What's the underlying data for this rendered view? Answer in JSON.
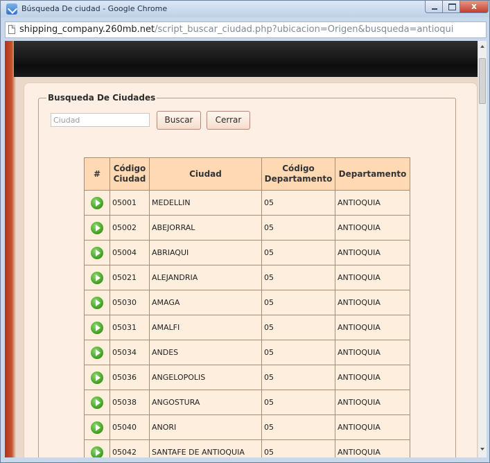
{
  "window": {
    "title": "Búsqueda De ciudad - Google Chrome",
    "close_glyph": "x"
  },
  "address_bar": {
    "host": "shipping_company.260mb.net",
    "path": "/script_buscar_ciudad.php?ubicacion=Origen&busqueda=antioqui"
  },
  "form": {
    "legend": "Busqueda De Ciudades",
    "search_placeholder": "Ciudad",
    "search_value": "",
    "buscar_label": "Buscar",
    "cerrar_label": "Cerrar"
  },
  "table": {
    "headers": {
      "hash": "#",
      "code_city": "Código Ciudad",
      "city": "Ciudad",
      "code_dept": "Código Departamento",
      "dept": "Departamento"
    },
    "rows": [
      {
        "code": "05001",
        "city": "MEDELLIN",
        "dept_code": "05",
        "dept": "ANTIOQUIA"
      },
      {
        "code": "05002",
        "city": "ABEJORRAL",
        "dept_code": "05",
        "dept": "ANTIOQUIA"
      },
      {
        "code": "05004",
        "city": "ABRIAQUI",
        "dept_code": "05",
        "dept": "ANTIOQUIA"
      },
      {
        "code": "05021",
        "city": "ALEJANDRIA",
        "dept_code": "05",
        "dept": "ANTIOQUIA"
      },
      {
        "code": "05030",
        "city": "AMAGA",
        "dept_code": "05",
        "dept": "ANTIOQUIA"
      },
      {
        "code": "05031",
        "city": "AMALFI",
        "dept_code": "05",
        "dept": "ANTIOQUIA"
      },
      {
        "code": "05034",
        "city": "ANDES",
        "dept_code": "05",
        "dept": "ANTIOQUIA"
      },
      {
        "code": "05036",
        "city": "ANGELOPOLIS",
        "dept_code": "05",
        "dept": "ANTIOQUIA"
      },
      {
        "code": "05038",
        "city": "ANGOSTURA",
        "dept_code": "05",
        "dept": "ANTIOQUIA"
      },
      {
        "code": "05040",
        "city": "ANORI",
        "dept_code": "05",
        "dept": "ANTIOQUIA"
      },
      {
        "code": "05042",
        "city": "SANTAFE DE ANTIOQUIA",
        "dept_code": "05",
        "dept": "ANTIOQUIA"
      }
    ]
  },
  "icons": {
    "app": "chrome-app-icon",
    "page": "page-icon",
    "row_action": "play-icon"
  },
  "colors": {
    "header_bar": "#1a1a1a",
    "panel_bg": "#fdefe3",
    "table_header_bg": "#ffd9b3",
    "page_left_accent": "#b3311c",
    "play_icon": "#3f9b1e"
  }
}
